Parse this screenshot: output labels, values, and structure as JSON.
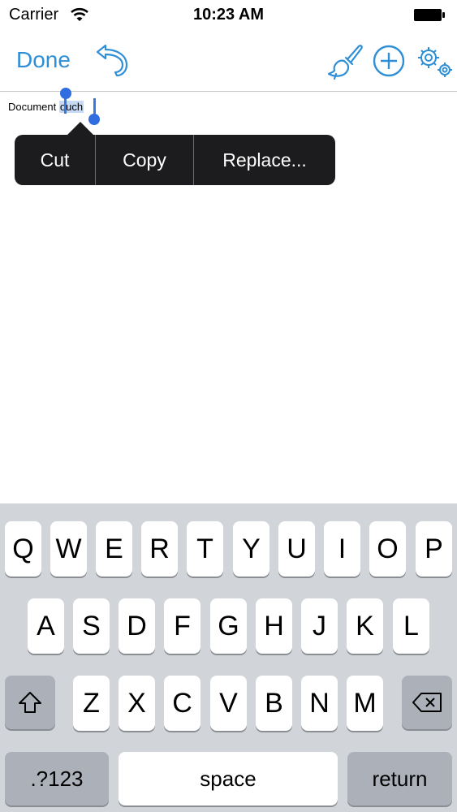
{
  "status_bar": {
    "carrier": "Carrier",
    "time": "10:23 AM"
  },
  "toolbar": {
    "done_label": "Done",
    "icons": [
      "undo-icon",
      "paint-brush-icon",
      "add-circle-icon",
      "settings-gears-icon"
    ],
    "accent_color": "#2f8fd6"
  },
  "document": {
    "word1": "Document",
    "selected_word": "ouch"
  },
  "edit_menu": {
    "cut": "Cut",
    "copy": "Copy",
    "replace": "Replace..."
  },
  "keyboard": {
    "row1": [
      "Q",
      "W",
      "E",
      "R",
      "T",
      "Y",
      "U",
      "I",
      "O",
      "P"
    ],
    "row2": [
      "A",
      "S",
      "D",
      "F",
      "G",
      "H",
      "J",
      "K",
      "L"
    ],
    "row3": [
      "Z",
      "X",
      "C",
      "V",
      "B",
      "N",
      "M"
    ],
    "numbers_label": ".?123",
    "space_label": "space",
    "return_label": "return"
  }
}
